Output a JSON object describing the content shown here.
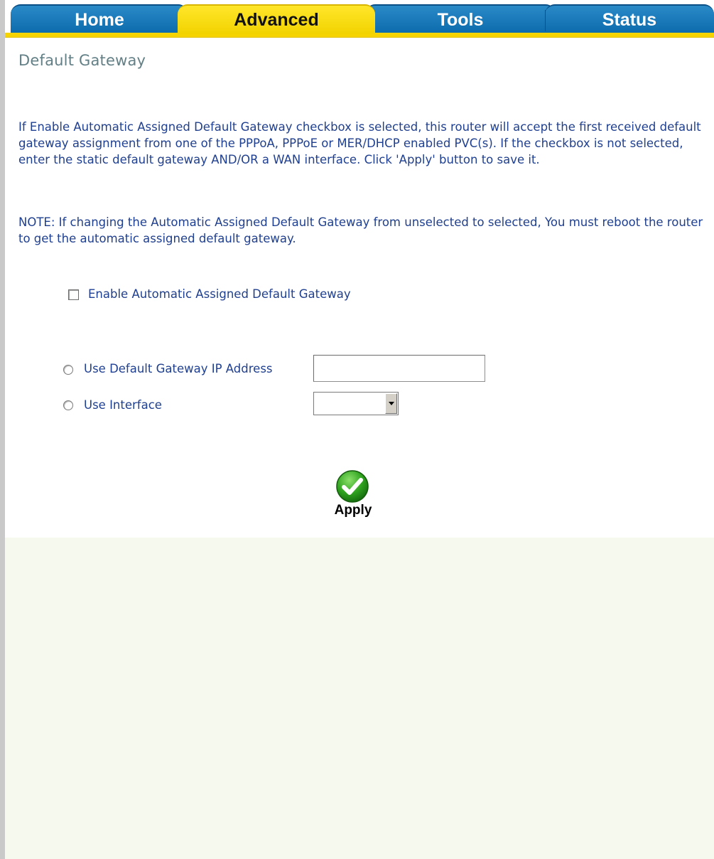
{
  "tabs": {
    "home": "Home",
    "advanced": "Advanced",
    "tools": "Tools",
    "status": "Status",
    "active": "Advanced"
  },
  "page": {
    "title": "Default Gateway",
    "description": "If Enable Automatic Assigned Default Gateway checkbox is selected, this router will accept the first received default gateway assignment from one of the PPPoA, PPPoE or MER/DHCP enabled PVC(s). If the checkbox is not selected, enter the static default gateway AND/OR a WAN interface. Click 'Apply' button to save it.",
    "note": "NOTE: If changing the Automatic Assigned Default Gateway from unselected to selected, You must reboot the router to get the automatic assigned default gateway."
  },
  "form": {
    "auto_gateway_label": "Enable Automatic Assigned Default Gateway",
    "auto_gateway_checked": false,
    "use_ip_label": "Use Default Gateway IP Address",
    "ip_value": "",
    "use_interface_label": "Use Interface",
    "interface_value": "",
    "apply_label": "Apply"
  },
  "colors": {
    "tab_blue": "#0b6aab",
    "tab_active_yellow": "#f5d400",
    "text_blue": "#1f3f8f",
    "title_gray": "#627f86",
    "apply_green": "#2fa31f"
  }
}
